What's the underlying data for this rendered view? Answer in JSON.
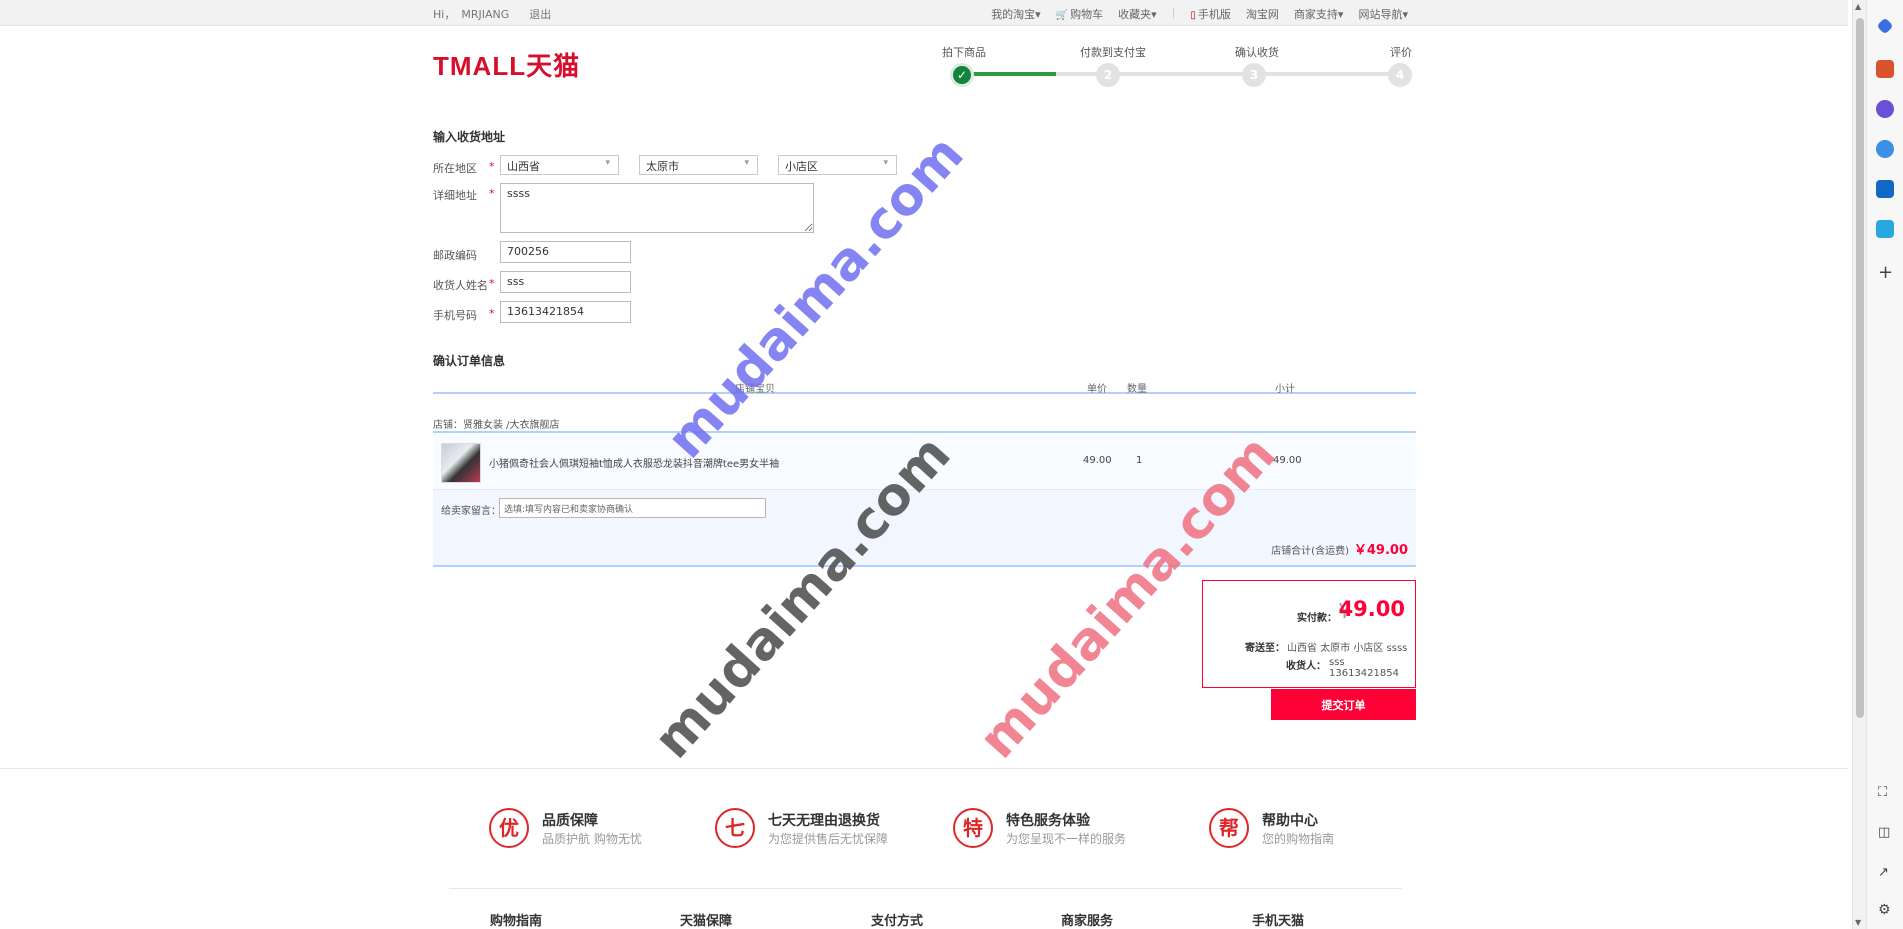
{
  "topbar": {
    "greeting": "Hi，",
    "username": "MRJIANG",
    "logout": "退出",
    "nav": {
      "my_taobao": "我的淘宝▾",
      "cart": "购物车",
      "favorites": "收藏夹▾",
      "mobile": "手机版",
      "taobao": "淘宝网",
      "merchant": "商家支持▾",
      "site_nav": "网站导航▾"
    }
  },
  "logo": {
    "text": "TMALL天猫"
  },
  "steps": [
    {
      "label": "拍下商品",
      "num": "✓"
    },
    {
      "label": "付款到支付宝",
      "num": "2"
    },
    {
      "label": "确认收货",
      "num": "3"
    },
    {
      "label": "评价",
      "num": "4"
    }
  ],
  "address": {
    "title": "输入收货地址",
    "region_label": "所在地区",
    "province": "山西省",
    "city": "太原市",
    "district": "小店区",
    "detail_label": "详细地址",
    "detail": "ssss",
    "zip_label": "邮政编码",
    "zip": "700256",
    "name_label": "收货人姓名",
    "name": "sss",
    "phone_label": "手机号码",
    "phone": "13613421854",
    "required": "*"
  },
  "order": {
    "title": "确认订单信息",
    "headers": {
      "product": "店铺宝贝",
      "unit_price": "单价",
      "quantity": "数量",
      "subtotal": "小计"
    },
    "shop": "店铺：贤雅女装 /大衣旗舰店",
    "item": {
      "name": "小猪佩奇社会人佩琪短袖t恤成人衣服恐龙装抖音潮牌tee男女半袖",
      "price": "49.00",
      "qty": "1",
      "subtotal": "49.00"
    },
    "message_label": "给卖家留言：",
    "message_placeholder": "选填:填写内容已和卖家协商确认",
    "shop_total_label": "店铺合计(含运费)",
    "shop_total": "￥49.00"
  },
  "summary": {
    "pay_label": "实付款：",
    "yen": "¥",
    "pay_value": "49.00",
    "ship_label": "寄送至：",
    "ship_value": "山西省  太原市  小店区  ssss",
    "receiver_label": "收货人：",
    "receiver_value": "sss  13613421854",
    "submit": "提交订单"
  },
  "watermark": "mudaima.com",
  "footer": {
    "promises": [
      {
        "icon": "优",
        "title": "品质保障",
        "sub": "品质护航 购物无忧"
      },
      {
        "icon": "七",
        "title": "七天无理由退换货",
        "sub": "为您提供售后无忧保障"
      },
      {
        "icon": "特",
        "title": "特色服务体验",
        "sub": "为您呈现不一样的服务"
      },
      {
        "icon": "帮",
        "title": "帮助中心",
        "sub": "您的购物指南"
      }
    ],
    "links": [
      "购物指南",
      "天猫保障",
      "支付方式",
      "商家服务",
      "手机天猫"
    ]
  }
}
